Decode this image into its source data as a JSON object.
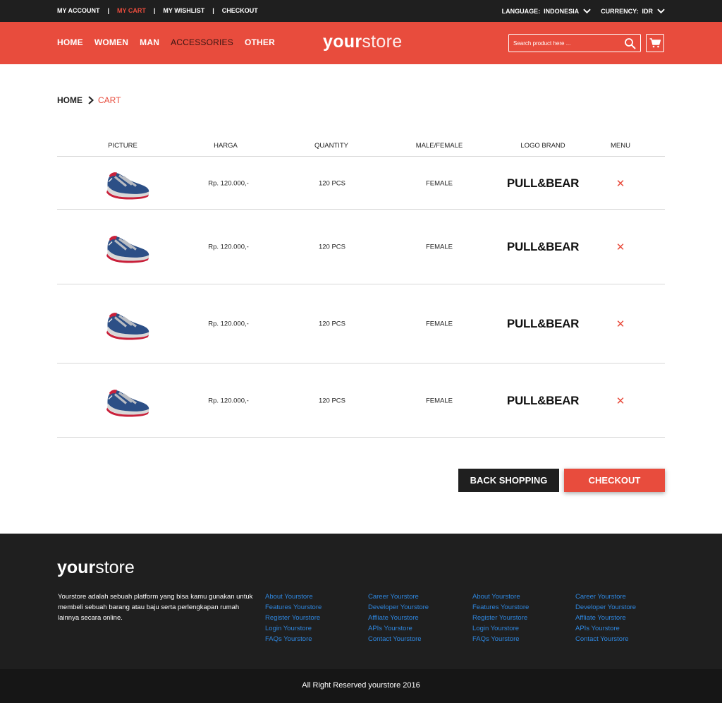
{
  "topbar": {
    "links": [
      "MY ACCOUNT",
      "MY CART",
      "MY WISHLIST",
      "CHECKOUT"
    ],
    "separator": "|",
    "language_label": "LANGUAGE:",
    "language_value": "INDONESIA",
    "currency_label": "CURRENCY:",
    "currency_value": "IDR"
  },
  "header": {
    "nav": [
      "HOME",
      "WOMEN",
      "MAN",
      "ACCESSORIES",
      "OTHER"
    ],
    "logo_bold": "your",
    "logo_light": "store",
    "search_placeholder": "Search product here ..."
  },
  "breadcrumb": {
    "home": "HOME",
    "current": "CART"
  },
  "table": {
    "headers": [
      "PICTURE",
      "HARGA",
      "QUANTITY",
      "MALE/FEMALE",
      "LOGO BRAND",
      "MENU"
    ],
    "rows": [
      {
        "price": "Rp. 120.000,-",
        "quantity": "120 PCS",
        "gender": "FEMALE",
        "brand": "PULL&BEAR",
        "remove": "✕"
      },
      {
        "price": "Rp. 120.000,-",
        "quantity": "120 PCS",
        "gender": "FEMALE",
        "brand": "PULL&BEAR",
        "remove": "✕"
      },
      {
        "price": "Rp. 120.000,-",
        "quantity": "120 PCS",
        "gender": "FEMALE",
        "brand": "PULL&BEAR",
        "remove": "✕"
      },
      {
        "price": "Rp. 120.000,-",
        "quantity": "120 PCS",
        "gender": "FEMALE",
        "brand": "PULL&BEAR",
        "remove": "✕"
      }
    ]
  },
  "actions": {
    "back": "BACK SHOPPING",
    "checkout": "CHECKOUT"
  },
  "footer": {
    "logo_bold": "your",
    "logo_light": "store",
    "description": "Yourstore adalah sebuah platform yang bisa kamu gunakan untuk membeli sebuah barang atau baju serta perlengkapan rumah lainnya secara online.",
    "col1": [
      "About Yourstore",
      "Features Yourstore",
      "Register Yourstore",
      "Login Yourstore",
      "FAQs Yourstore"
    ],
    "col2": [
      "Career Yourstore",
      "Developer Yourstore",
      "Affliate Yourstore",
      "APIs Yourstore",
      "Contact Yourstore"
    ],
    "col3": [
      "About Yourstore",
      "Features Yourstore",
      "Register Yourstore",
      "Login Yourstore",
      "FAQs Yourstore"
    ],
    "col4": [
      "Career Yourstore",
      "Developer Yourstore",
      "Affliate Yourstore",
      "APIs Yourstore",
      "Contact Yourstore"
    ],
    "copyright": "All Right Reserved yourstore 2016"
  },
  "colors": {
    "accent": "#e84c3d",
    "dark": "#1f1f1f",
    "link": "#2e86de"
  }
}
